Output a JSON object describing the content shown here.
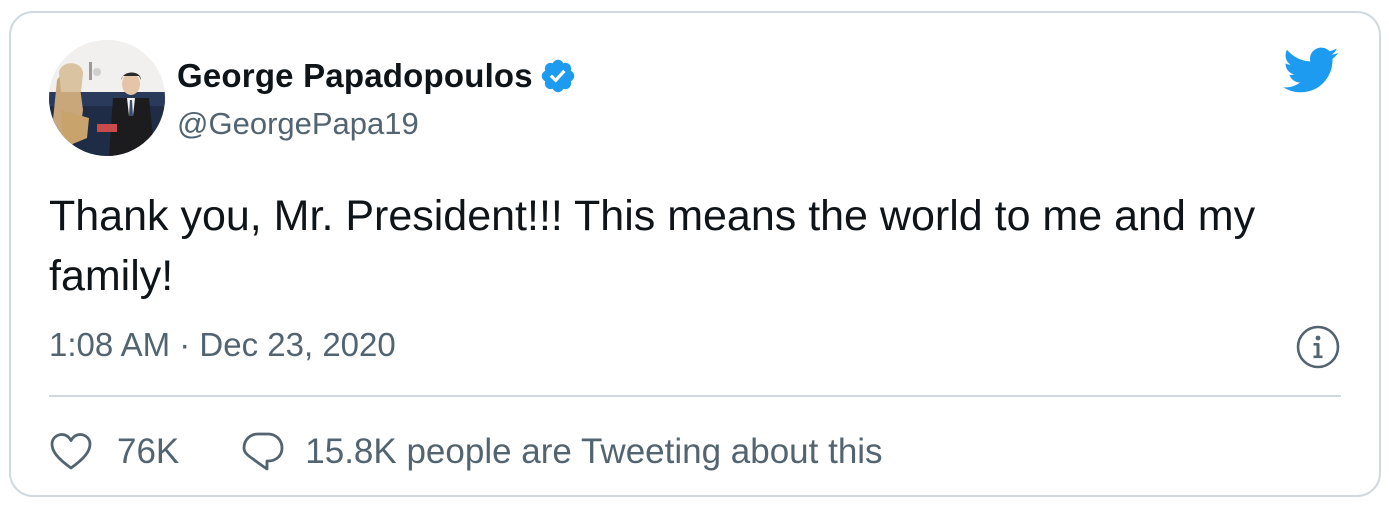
{
  "author": {
    "display_name": "George Papadopoulos",
    "handle": "@GeorgePapa19",
    "verified": true
  },
  "tweet": {
    "text": "Thank you, Mr. President!!! This means the world to me and my family!",
    "time": "1:08 AM",
    "separator": "·",
    "date": "Dec 23, 2020"
  },
  "engagement": {
    "likes": "76K",
    "conversation_text": "15.8K people are Tweeting about this"
  },
  "icons": {
    "brand": "twitter-bird-icon",
    "verified": "verified-badge-icon",
    "info": "info-icon",
    "like": "heart-icon",
    "reply": "speech-bubble-icon"
  },
  "colors": {
    "brand_blue": "#1d9bf0",
    "text_primary": "#0f1419",
    "text_secondary": "#536471",
    "border": "#cfd9de"
  }
}
